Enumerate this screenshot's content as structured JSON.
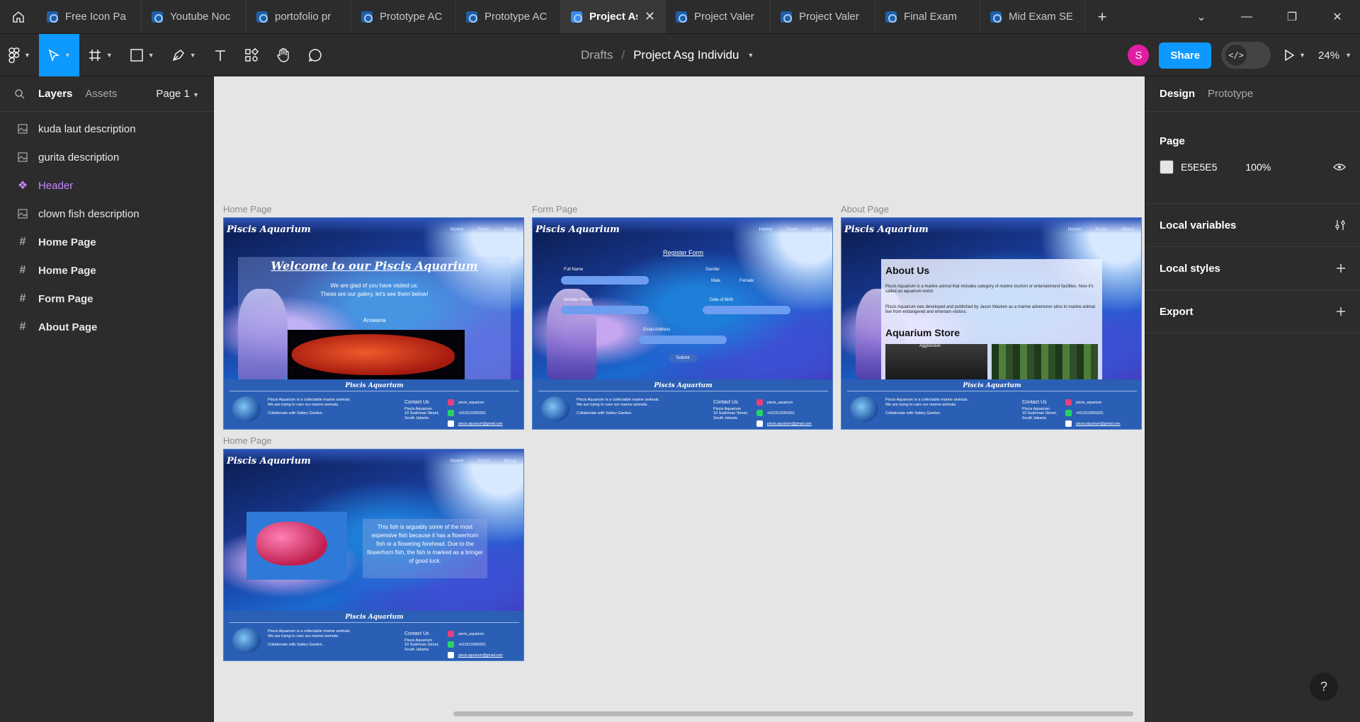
{
  "tabs": [
    {
      "label": "Free Icon Pa",
      "active": false
    },
    {
      "label": "Youtube Noc",
      "active": false
    },
    {
      "label": "portofolio pr",
      "active": false
    },
    {
      "label": "Prototype AC",
      "active": false
    },
    {
      "label": "Prototype AC",
      "active": false
    },
    {
      "label": "Project As",
      "active": true
    },
    {
      "label": "Project Valer",
      "active": false
    },
    {
      "label": "Project Valer",
      "active": false
    },
    {
      "label": "Final Exam",
      "active": false
    },
    {
      "label": "Mid Exam SE",
      "active": false
    }
  ],
  "tab_close": "✕",
  "add_tab": "+",
  "window_controls": [
    "⌄",
    "—",
    "❐",
    "✕"
  ],
  "toolbar": {
    "breadcrumb": "Drafts",
    "separator": "/",
    "file_name": "Project Asg Individu",
    "avatar_initial": "S",
    "share_label": "Share",
    "devmode_label": "</>",
    "zoom": "24%"
  },
  "left_panel": {
    "tab_layers": "Layers",
    "tab_assets": "Assets",
    "page_selector": "Page 1",
    "layers": [
      {
        "name": "kuda laut description",
        "type": "image"
      },
      {
        "name": "gurita description",
        "type": "image"
      },
      {
        "name": "Header",
        "type": "component"
      },
      {
        "name": "clown fish description",
        "type": "image"
      },
      {
        "name": "Home Page",
        "type": "frame"
      },
      {
        "name": "Home Page",
        "type": "frame"
      },
      {
        "name": "Form Page",
        "type": "frame"
      },
      {
        "name": "About Page",
        "type": "frame"
      }
    ]
  },
  "canvas": {
    "background": "#E5E5E5",
    "frames": {
      "home1_label": "Home Page",
      "form_label": "Form Page",
      "about_label": "About Page",
      "home2_label": "Home Page"
    },
    "site": {
      "brand": "Piscis Aquarium",
      "nav": [
        "Home",
        "Form",
        "About"
      ],
      "footer_title": "Piscis Aquarium",
      "footer_text_1": "Piscis Aquarium is a collectable marine animals.",
      "footer_text_2": "We are trying to care our marine animals.",
      "footer_text_3": "Collaborate with Safary Garden.",
      "contact_title": "Contact Us",
      "contact_lines": [
        "Piscis Aquarium",
        "10 Sudirman Street,",
        "South Jakarta"
      ],
      "instagram": "piscis_aquarium",
      "phone": "+6219132909201",
      "email": "piscis.aquarium@gmail.com"
    },
    "home": {
      "welcome": "Welcome to our Piscis Aquarium",
      "sub_1": "We are glad of you have visited us.",
      "sub_2": "These are our galery, let's see them below!",
      "caption": "Arowana"
    },
    "form": {
      "title": "Register Form",
      "full_name": "Full Name",
      "gender": "Gender",
      "male": "Male",
      "female": "Female",
      "phone": "Number Phone",
      "dob": "Date of Birth",
      "email": "Email Address",
      "submit": "Submit"
    },
    "about": {
      "heading": "About Us",
      "p1": "Piscis Aquarium is a marine animal that includes category of marine tourism or entertainment facilities. Now it's called an aquarium world.",
      "p2": "Piscis Aquarium was developed and published by Jason Wacken as a marine adventurer aims to marine animal live from endangered and entertain visitors.",
      "store_heading": "Aquarium Store",
      "store_label": "Aggressive"
    },
    "home2": {
      "desc": "This fish is arguably some of the most expensive fish because it has a flowerhorn fish or a flowering forehead. Due to the flowerhorn fish, the fish is marked as a bringer of good luck."
    }
  },
  "right_panel": {
    "tab_design": "Design",
    "tab_prototype": "Prototype",
    "page_heading": "Page",
    "page_color": "E5E5E5",
    "page_opacity": "100%",
    "local_variables": "Local variables",
    "local_styles": "Local styles",
    "export": "Export"
  },
  "help": "?"
}
